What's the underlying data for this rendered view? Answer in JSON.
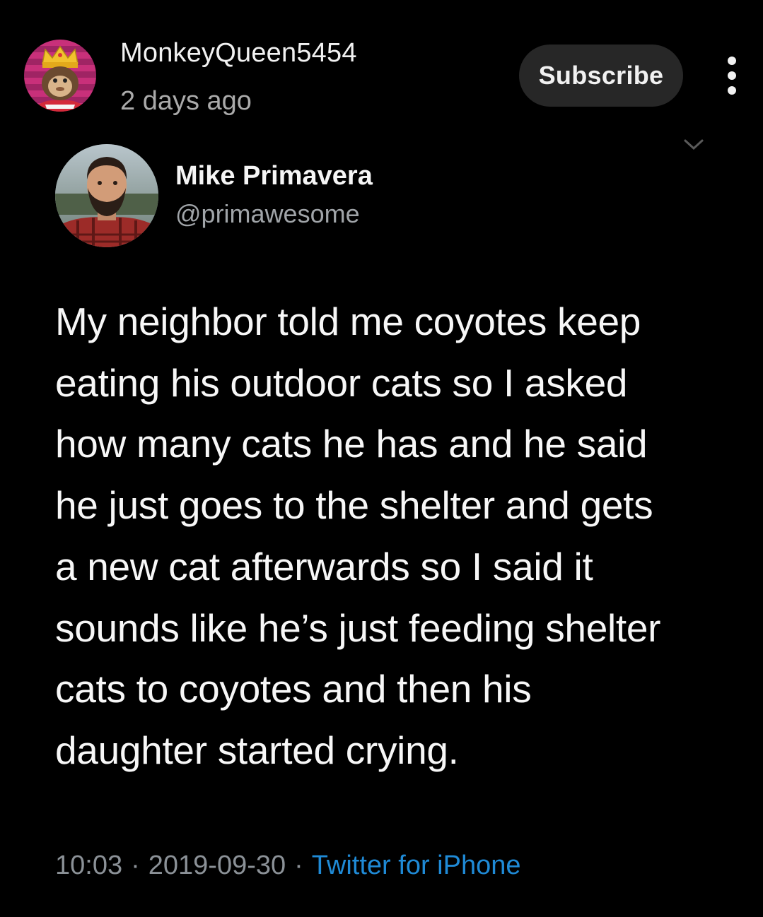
{
  "post": {
    "channel_name": "MonkeyQueen5454",
    "time_ago": "2 days ago",
    "subscribe_label": "Subscribe",
    "more_icon": "vertical-ellipsis-icon",
    "collapse_icon": "chevron-down-icon"
  },
  "tweet": {
    "display_name": "Mike Primavera",
    "handle": "@primawesome",
    "lines": [
      "My neighbor told me coyotes keep",
      "eating his outdoor cats so I asked",
      "how many cats he has and he said",
      "he just goes to the shelter and gets",
      "a new cat afterwards so I said it",
      "sounds like he’s just feeding shelter",
      "cats to coyotes and then his",
      "daughter started crying."
    ],
    "time": "10:03",
    "separator": "·",
    "date": "2019-09-30",
    "source": "Twitter for iPhone"
  },
  "colors": {
    "background": "#000000",
    "subscribe_bg": "#272727",
    "secondary_text": "#aaaaaa",
    "link": "#1f8ad6"
  }
}
